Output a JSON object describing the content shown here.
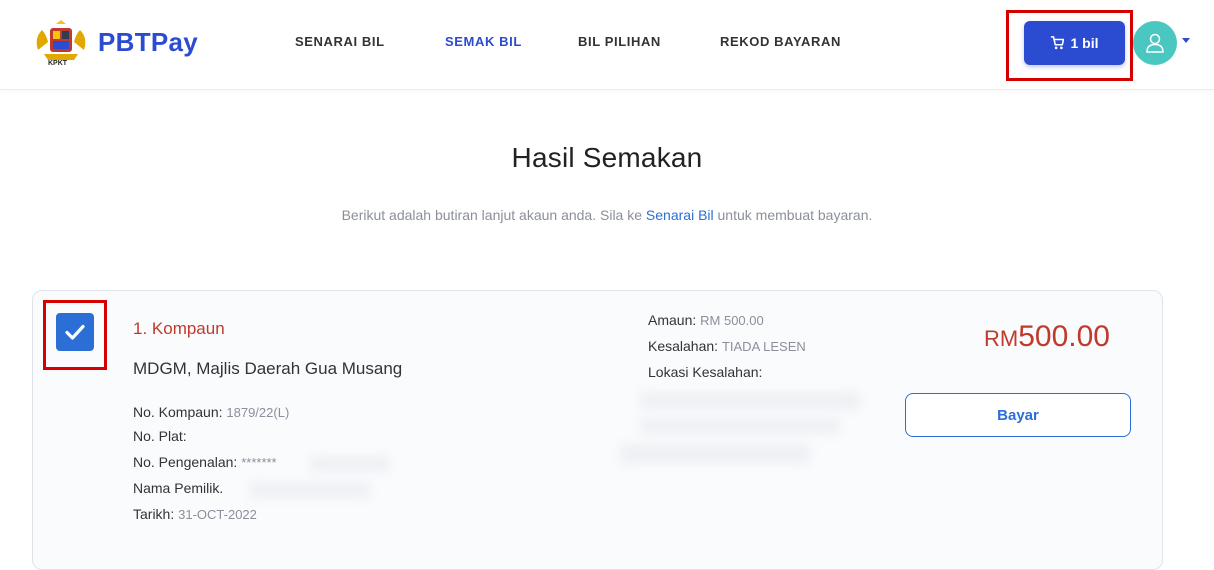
{
  "header": {
    "brand": "PBTPay",
    "logo_caption": "KPKT",
    "nav": [
      {
        "label": "SENARAI BIL",
        "active": false
      },
      {
        "label": "SEMAK BIL",
        "active": true
      },
      {
        "label": "BIL PILIHAN",
        "active": false
      },
      {
        "label": "REKOD BAYARAN",
        "active": false
      }
    ],
    "cart_label": "1 bil",
    "accent_color": "#2b4bd1"
  },
  "page": {
    "title": "Hasil Semakan",
    "subtitle_before": "Berikut adalah butiran lanjut akaun anda. Sila ke ",
    "subtitle_link": "Senarai Bil",
    "subtitle_after": " untuk membuat bayaran."
  },
  "bill": {
    "checked": true,
    "title": "1. Kompaun",
    "org": "MDGM, Majlis Daerah Gua Musang",
    "fields": [
      {
        "label": "No. Kompaun:",
        "value": "1879/22(L)"
      },
      {
        "label": "No. Plat:",
        "value": ""
      },
      {
        "label": "No. Pengenalan:",
        "value": "*******"
      },
      {
        "label": "Nama Pemilik.",
        "value": ""
      },
      {
        "label": "Tarikh:",
        "value": "31-OCT-2022"
      }
    ],
    "right_fields": [
      {
        "label": "Amaun:",
        "value": "RM 500.00"
      },
      {
        "label": "Kesalahan:",
        "value": "TIADA LESEN"
      },
      {
        "label": "Lokasi Kesalahan:",
        "value": ""
      }
    ],
    "amount_currency": "RM",
    "amount_value": "500.00",
    "pay_label": "Bayar"
  }
}
